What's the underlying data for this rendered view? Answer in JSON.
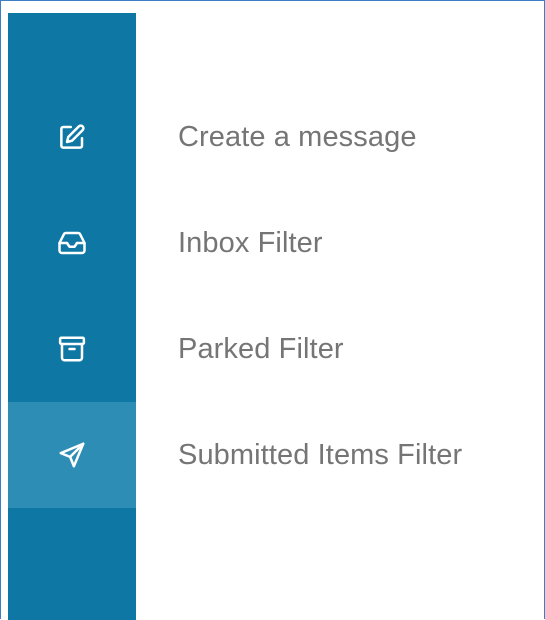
{
  "sidebar": {
    "items": [
      {
        "label": "Create a message",
        "icon": "compose-icon",
        "active": false
      },
      {
        "label": "Inbox Filter",
        "icon": "inbox-icon",
        "active": false
      },
      {
        "label": "Parked Filter",
        "icon": "archive-box-icon",
        "active": false
      },
      {
        "label": "Submitted Items Filter",
        "icon": "send-icon",
        "active": true
      }
    ]
  },
  "colors": {
    "rail": "#0f77a3",
    "rail_active": "#2e8db5",
    "label": "#757575",
    "frame_border": "#3d7fc4"
  }
}
